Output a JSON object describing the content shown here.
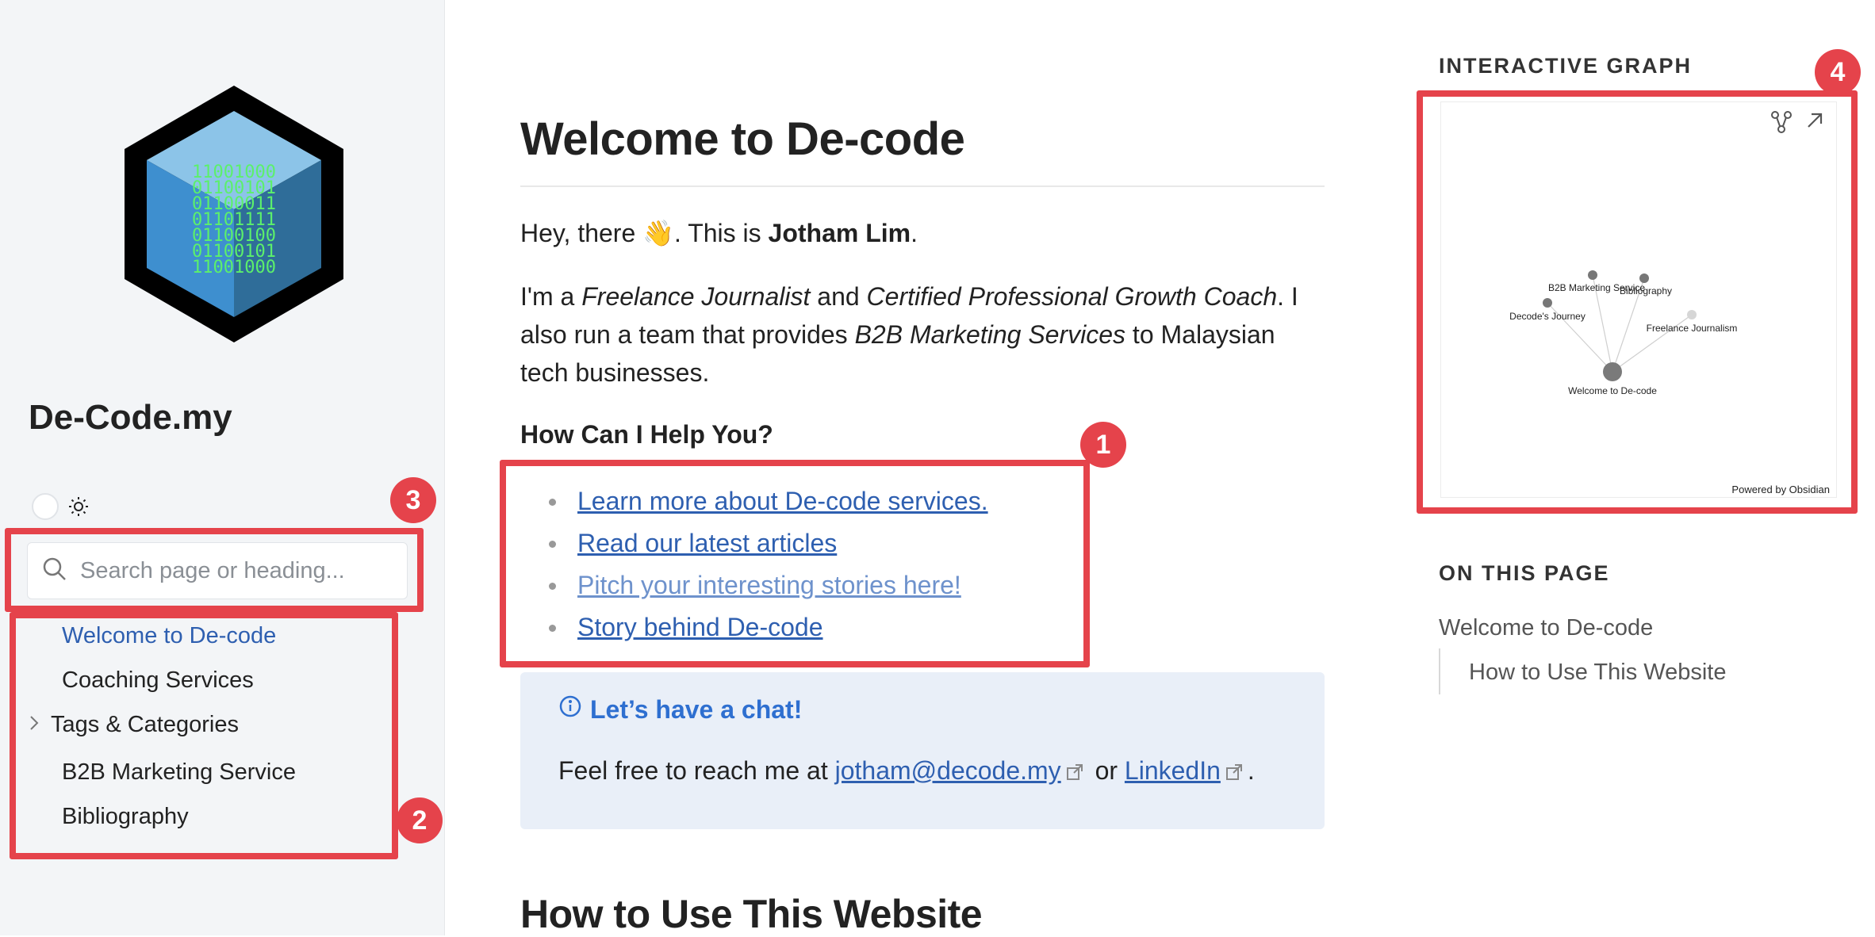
{
  "sidebar": {
    "logo_binary": [
      "11001000",
      "01100101",
      "01100011",
      "01101111",
      "01100100",
      "01100101",
      "11001000"
    ],
    "site_title": "De-Code.my",
    "search_placeholder": "Search page or heading...",
    "nav": {
      "welcome": "Welcome to De-code",
      "coaching": "Coaching Services",
      "tags": "Tags & Categories",
      "b2b": "B2B Marketing Service",
      "bibliography": "Bibliography"
    }
  },
  "main": {
    "title": "Welcome to De-code",
    "intro_greeting": "Hey, there 👋. This is ",
    "intro_name": "Jotham Lim",
    "intro_end": ".",
    "bio_1": "I'm a ",
    "bio_role_1": "Freelance Journalist",
    "bio_and": " and ",
    "bio_role_2": "Certified Professional Growth Coach",
    "bio_2": ". I also run a team that provides ",
    "bio_service": "B2B Marketing Services",
    "bio_3": " to Malaysian tech businesses.",
    "help_heading": "How Can I Help You?",
    "links": {
      "services": "Learn more about De-code services.",
      "articles": "Read our latest articles",
      "pitch": "Pitch your interesting stories here!",
      "story": "Story behind De-code"
    },
    "callout": {
      "title": "Let’s have a chat!",
      "body_prefix": "Feel free to reach me at ",
      "email": "jotham@decode.my",
      "or": " or ",
      "linkedin": "LinkedIn",
      "end": "."
    },
    "section_2_title": "How to Use This Website"
  },
  "right_panel": {
    "graph_label": "INTERACTIVE GRAPH",
    "graph_nodes": {
      "b2b": "B2B Marketing Service",
      "bibliography": "Bibliography",
      "journey": "Decode's Journey",
      "freelance": "Freelance Journalism",
      "welcome": "Welcome to De-code"
    },
    "powered_by": "Powered by Obsidian",
    "toc_label": "ON THIS PAGE",
    "toc": {
      "welcome": "Welcome to De-code",
      "how_to": "How to Use This Website"
    }
  },
  "annotations": {
    "one": "1",
    "two": "2",
    "three": "3",
    "four": "4"
  },
  "colors": {
    "link": "#2e5fb0",
    "callout_bg": "#e9eff8",
    "annotation": "#e5434b",
    "sidebar_bg": "#f3f5f7"
  }
}
